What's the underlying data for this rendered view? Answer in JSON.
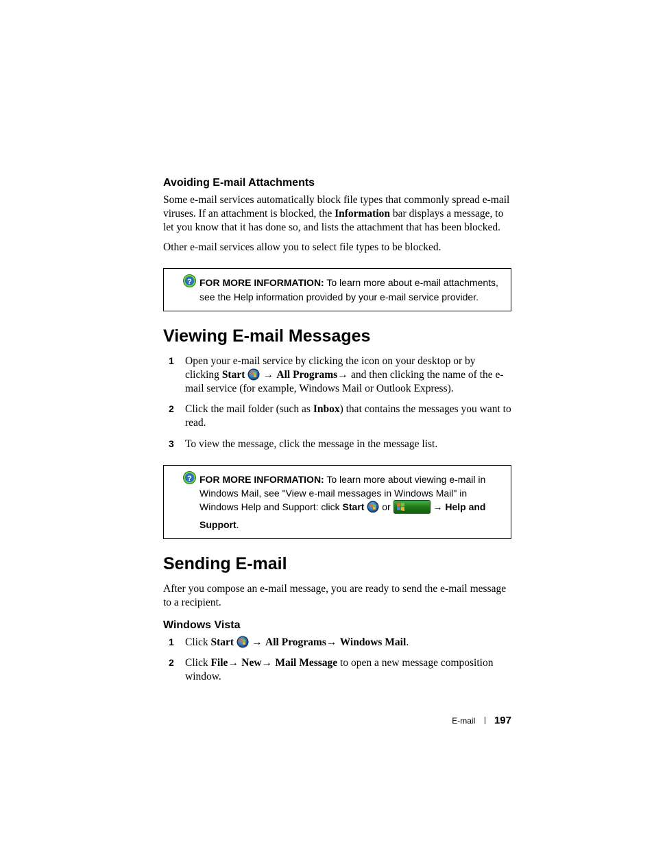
{
  "section1": {
    "heading": "Avoiding E-mail Attachments",
    "p1_a": "Some e-mail services automatically block file types that commonly spread e-mail viruses. If an attachment is blocked, the ",
    "p1_b": "Information",
    "p1_c": " bar displays a message, to let you know that it has done so, and lists the attachment that has been blocked.",
    "p2": "Other e-mail services allow you to select file types to be blocked."
  },
  "info1": {
    "label": "FOR MORE INFORMATION:",
    "text": " To learn more about e-mail attachments, see the Help information provided by your e-mail service provider."
  },
  "section2": {
    "heading": "Viewing E-mail Messages",
    "step1_a": "Open your e-mail service by clicking the icon on your desktop or by clicking ",
    "step1_b": "Start",
    "step1_c": " ",
    "step1_arrow1": " → ",
    "step1_d": "All Programs",
    "step1_arrow2": "→ ",
    "step1_e": "and then clicking the name of the e-mail service (for example, Windows Mail or Outlook Express).",
    "step2_a": "Click the mail folder (such as ",
    "step2_b": "Inbox",
    "step2_c": ") that contains the messages you want to read.",
    "step3": "To view the message, click the message in the message list."
  },
  "info2": {
    "label": "FOR MORE INFORMATION:",
    "text_a": " To learn more about viewing e-mail in Windows Mail, see \"View e-mail messages in Windows Mail\" in Windows Help and Support: click ",
    "start": "Start",
    "or": " or ",
    "arrow": " → ",
    "help": "Help and Support",
    "period": "."
  },
  "section3": {
    "heading": "Sending E-mail",
    "intro": "After you compose an e-mail message, you are ready to send the e-mail message to a recipient.",
    "subhead": "Windows Vista",
    "step1_a": "Click ",
    "step1_b": "Start",
    "step1_arrow1": " → ",
    "step1_c": "All Programs",
    "step1_arrow2": "→ ",
    "step1_d": "Windows Mail",
    "step1_e": ".",
    "step2_a": "Click ",
    "step2_b": "File",
    "step2_arrow1": "→ ",
    "step2_c": "New",
    "step2_arrow2": "→ ",
    "step2_d": "Mail Message",
    "step2_e": " to open a new message composition window."
  },
  "footer": {
    "section": "E-mail",
    "page": "197"
  },
  "nums": {
    "n1": "1",
    "n2": "2",
    "n3": "3"
  }
}
